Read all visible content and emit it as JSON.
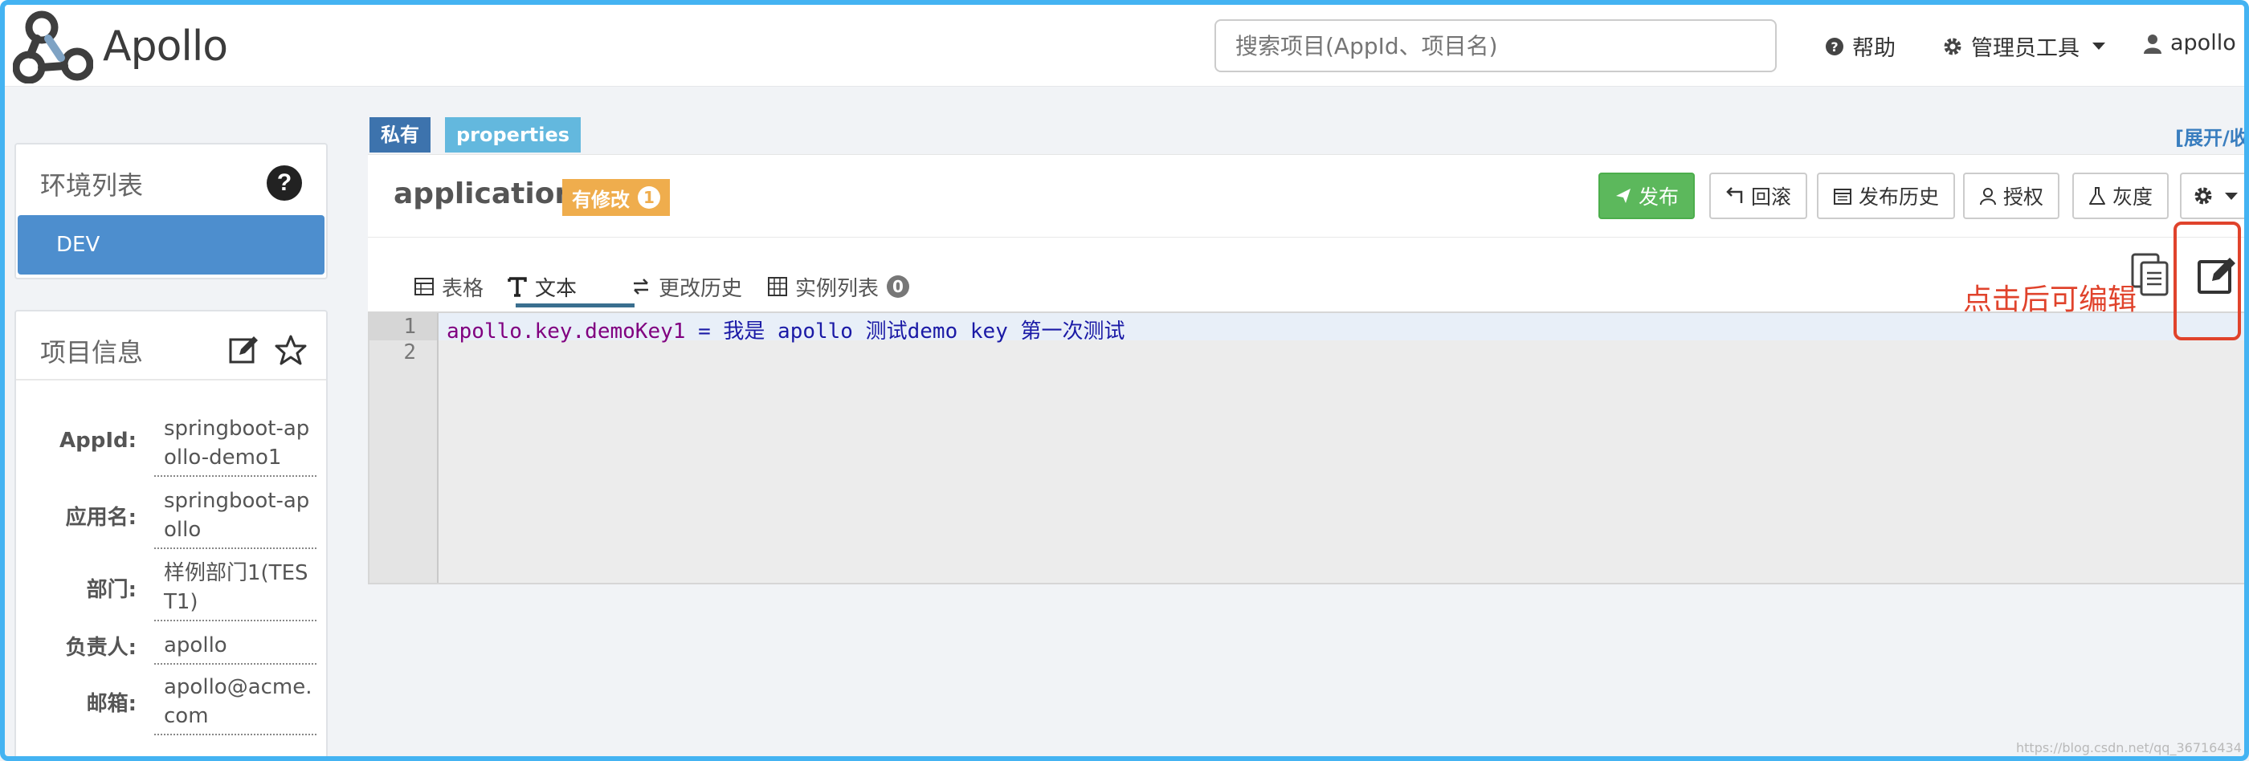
{
  "app": {
    "name": "Apollo"
  },
  "header": {
    "search_placeholder": "搜索项目(AppId、项目名)",
    "help_label": "帮助",
    "admin_tools_label": "管理员工具",
    "user_label": "apollo"
  },
  "sidebar": {
    "env_panel": {
      "title": "环境列表",
      "help_glyph": "?",
      "items": [
        {
          "label": "DEV"
        }
      ]
    },
    "project_panel": {
      "title": "项目信息",
      "fields": [
        {
          "label": "AppId:",
          "value": "springboot-apollo-demo1"
        },
        {
          "label": "应用名:",
          "value": "springboot-apollo"
        },
        {
          "label": "部门:",
          "value": "样例部门1(TEST1)"
        },
        {
          "label": "负责人:",
          "value": "apollo"
        },
        {
          "label": "邮箱:",
          "value": "apollo@acme.com"
        }
      ]
    }
  },
  "namespace": {
    "tags": {
      "scope": "私有",
      "format": "properties"
    },
    "expand_label": "[展开/收",
    "name": "application",
    "modified_label": "有修改",
    "modified_count": "1",
    "buttons": {
      "publish": "发布",
      "rollback": "回滚",
      "history": "发布历史",
      "authorize": "授权",
      "gray": "灰度"
    },
    "tabs": [
      {
        "label": "表格",
        "icon": "table-icon"
      },
      {
        "label": "文本",
        "icon": "text-icon"
      },
      {
        "label": "更改历史",
        "icon": "exchange-icon"
      },
      {
        "label": "实例列表",
        "icon": "instances-icon",
        "count": "0"
      }
    ],
    "active_tab": "文本",
    "annotation": "点击后可编辑"
  },
  "editor": {
    "lines": [
      {
        "no": "1",
        "key": "apollo.key.demoKey1",
        "op": "=",
        "value": "我是 apollo 测试demo key 第一次测试"
      },
      {
        "no": "2",
        "key": "",
        "op": "",
        "value": ""
      }
    ]
  },
  "colors": {
    "accent": "#4d8ece",
    "publish_green": "#5cb85c",
    "modified_orange": "#efad4d",
    "annotation_red": "#e0432c",
    "frame_blue": "#44b3f2"
  },
  "watermark": "https://blog.csdn.net/qq_36716434"
}
